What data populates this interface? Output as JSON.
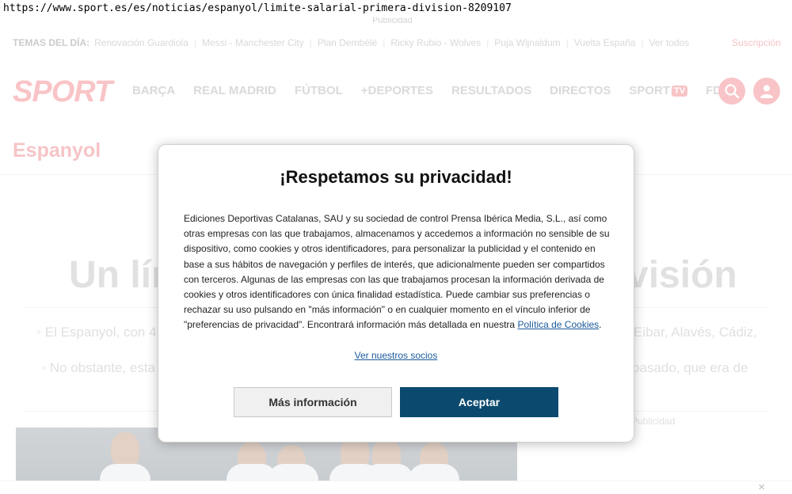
{
  "browser": {
    "url": "https://www.sport.es/es/noticias/espanyol/limite-salarial-primera-division-8209107"
  },
  "ads": {
    "top_label": "Publicidad",
    "right_label": "Publicidad"
  },
  "temas": {
    "label": "TEMAS DEL DÍA:",
    "items": [
      "Renovación Guardiola",
      "Messi - Manchester City",
      "Plan Dembélé",
      "Ricky Rubio - Wolves",
      "Puja Wijnaldum",
      "Vuelta España",
      "Ver todos"
    ],
    "subscribe": "Suscripción"
  },
  "header": {
    "logo": "SPORT",
    "nav": [
      "BARÇA",
      "REAL MADRID",
      "FÚTBOL",
      "+DEPORTES",
      "RESULTADOS",
      "DIRECTOS",
      "SPORT",
      "FDJ"
    ],
    "tv_badge": "TV"
  },
  "article": {
    "section": "Espanyol",
    "headline_start": "Un lím",
    "headline_end": "visión",
    "bullet1_left": "◦ El Espanyol, con 4",
    "bullet1_right": "Eibar, Alavés, Cádiz,",
    "bullet2_left": "◦ No obstante, esta",
    "bullet2_right": "pasado, que era de"
  },
  "consent": {
    "title": "¡Respetamos su privacidad!",
    "body": "Ediciones Deportivas Catalanas, SAU y su sociedad de control Prensa Ibérica Media, S.L., así como otras empresas con las que trabajamos, almacenamos y accedemos a información no sensible de su dispositivo, como cookies y otros identificadores, para personalizar la publicidad y el contenido en base a sus hábitos de navegación y perfiles de interés, que adicionalmente pueden ser compartidos con terceros. Algunas de las empresas con las que trabajamos procesan la información derivada de cookies y otros identificadores con única finalidad estadística. Puede cambiar sus preferencias o rechazar su uso pulsando en \"más información\" o en cualquier momento en el vínculo inferior de \"preferencias de privacidad\". Encontrará información más detallada en nuestra",
    "cookies_link": "Política de Cookies",
    "body_end": ".",
    "partners_link": "Ver nuestros socios",
    "more_button": "Más información",
    "accept_button": "Aceptar"
  },
  "footer": {
    "close": "×"
  },
  "colors": {
    "brand": "#e30613",
    "accept": "#0b4a6e",
    "link": "#1a5a9a"
  }
}
